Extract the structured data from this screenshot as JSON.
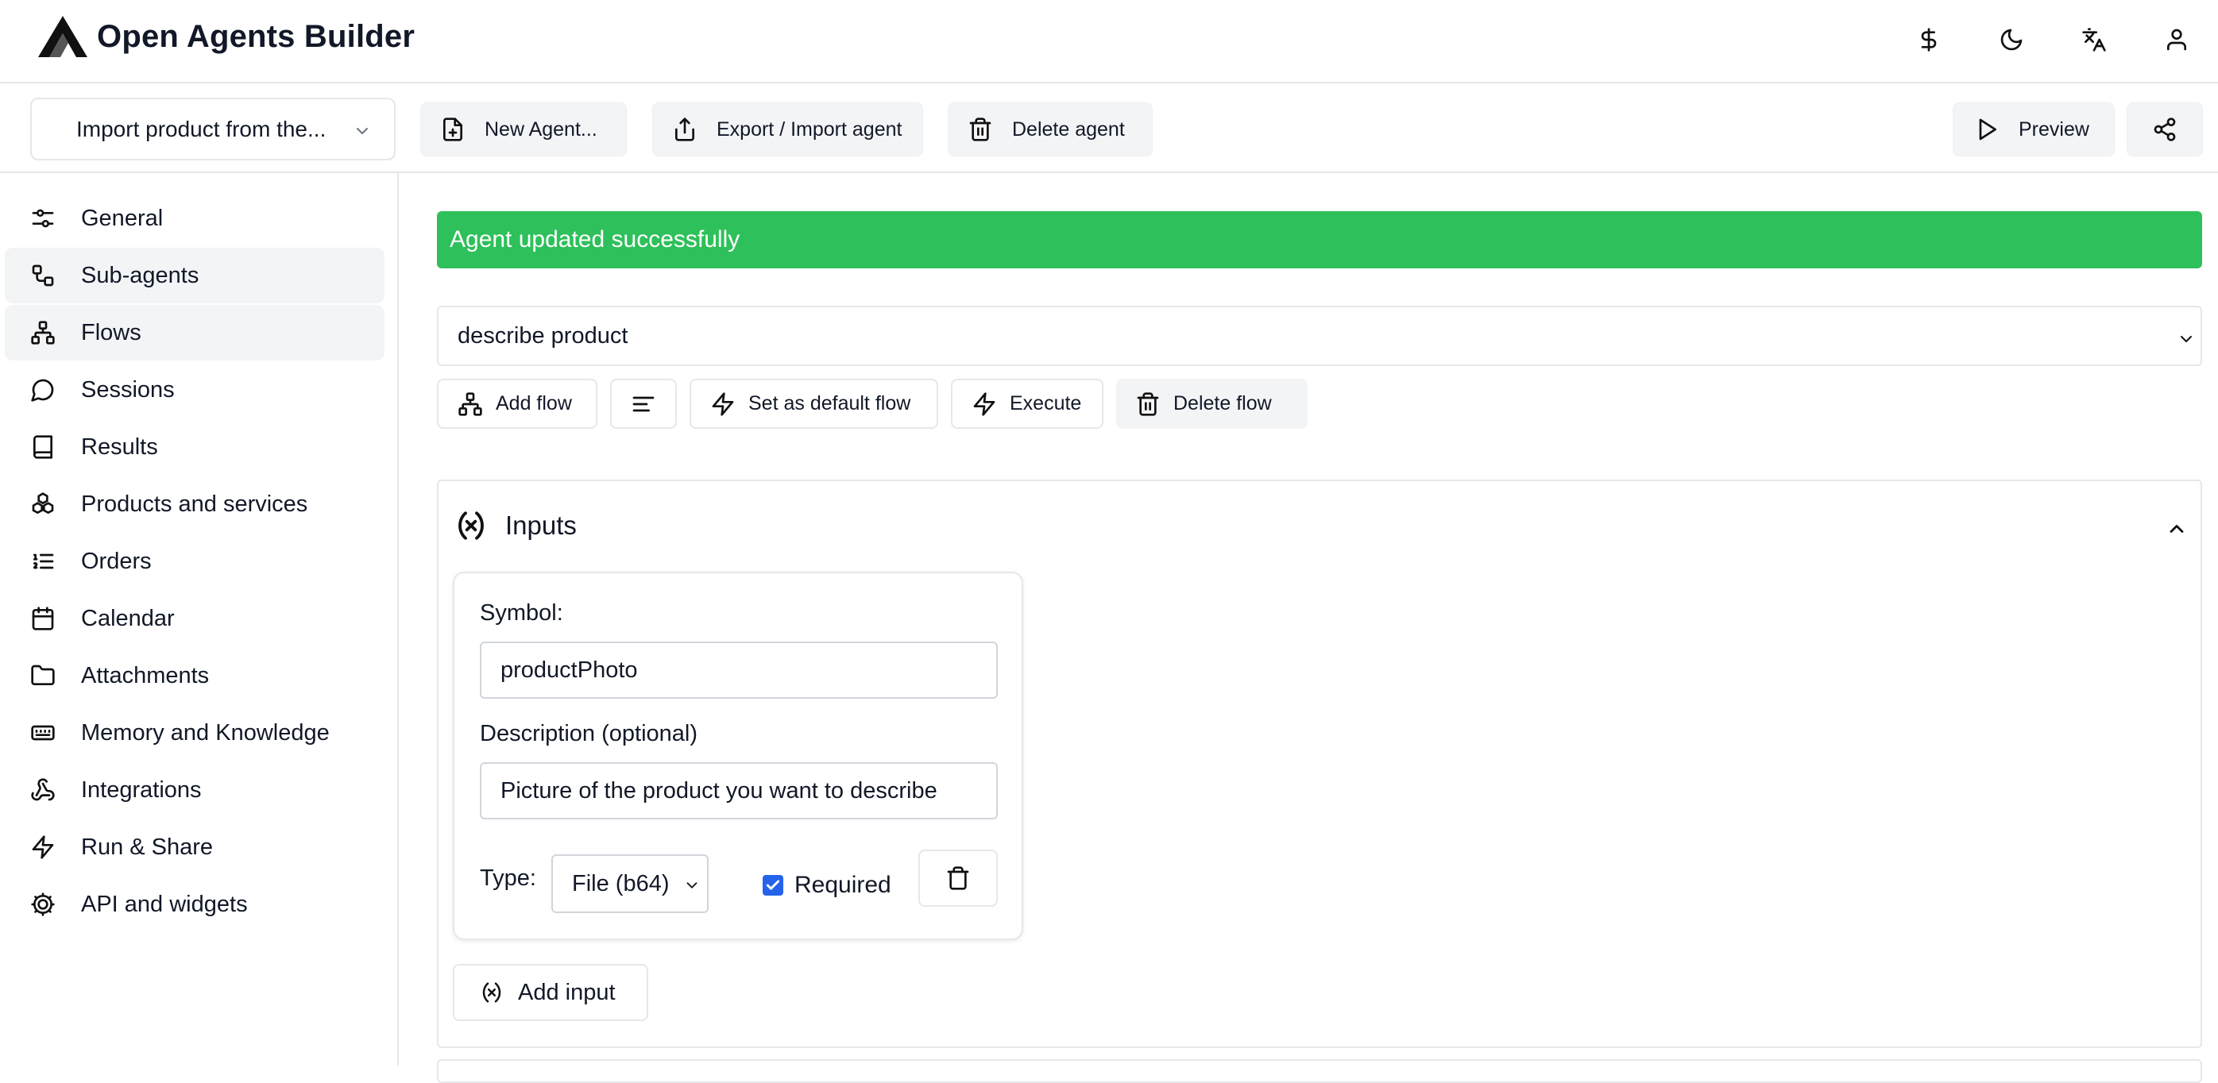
{
  "app": {
    "title": "Open Agents Builder"
  },
  "header_icons": [
    {
      "name": "dollar-icon"
    },
    {
      "name": "moon-icon"
    },
    {
      "name": "language-icon"
    },
    {
      "name": "user-icon"
    }
  ],
  "toolbar": {
    "agent_select": "Import product from the...",
    "new_agent": "New Agent...",
    "export_import": "Export / Import agent",
    "delete_agent": "Delete agent",
    "preview": "Preview"
  },
  "sidebar": {
    "items": [
      {
        "label": "General",
        "icon": "sliders-icon",
        "active": false
      },
      {
        "label": "Sub-agents",
        "icon": "sub-agents-icon",
        "active": true
      },
      {
        "label": "Flows",
        "icon": "flows-icon",
        "active": true
      },
      {
        "label": "Sessions",
        "icon": "chat-icon",
        "active": false
      },
      {
        "label": "Results",
        "icon": "book-icon",
        "active": false
      },
      {
        "label": "Products and services",
        "icon": "boxes-icon",
        "active": false
      },
      {
        "label": "Orders",
        "icon": "list-ordered-icon",
        "active": false
      },
      {
        "label": "Calendar",
        "icon": "calendar-icon",
        "active": false
      },
      {
        "label": "Attachments",
        "icon": "folder-icon",
        "active": false
      },
      {
        "label": "Memory and Knowledge",
        "icon": "memory-icon",
        "active": false
      },
      {
        "label": "Integrations",
        "icon": "webhook-icon",
        "active": false
      },
      {
        "label": "Run & Share",
        "icon": "zap-icon",
        "active": false
      },
      {
        "label": "API and widgets",
        "icon": "cog-icon",
        "active": false
      }
    ]
  },
  "main": {
    "alert": "Agent updated successfully",
    "flow_select": "describe product",
    "flow_buttons": {
      "add_flow": "Add flow",
      "set_default": "Set as default flow",
      "execute": "Execute",
      "delete_flow": "Delete flow"
    },
    "inputs_panel": {
      "title": "Inputs",
      "symbol_label": "Symbol:",
      "symbol_value": "productPhoto",
      "description_label": "Description (optional)",
      "description_value": "Picture of the product you want to describe",
      "type_label": "Type:",
      "type_value": "File (b64)",
      "required_label": "Required",
      "required_checked": true,
      "add_input": "Add input"
    }
  },
  "colors": {
    "success": "#2ec05a",
    "checkbox": "#2563eb",
    "active_item": "#f3f4f6"
  }
}
